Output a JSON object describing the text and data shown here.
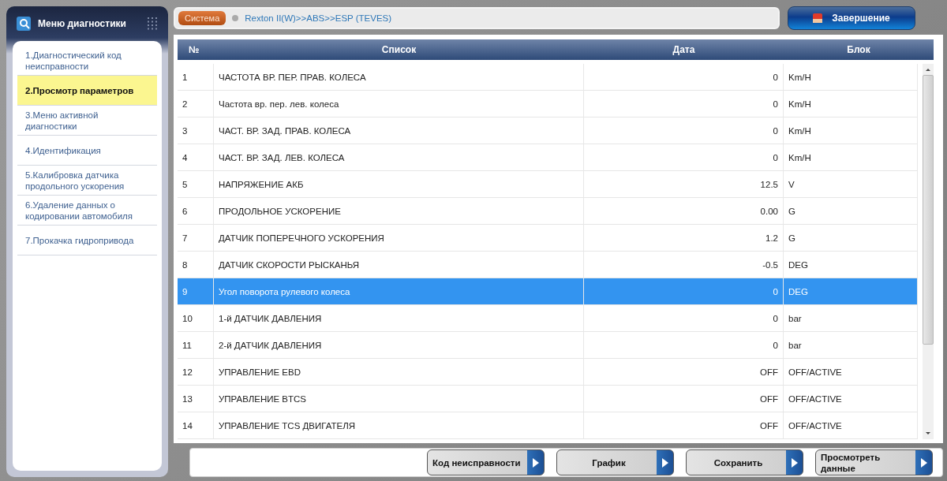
{
  "sidebar": {
    "title": "Меню диагностики",
    "items": [
      {
        "label": "1.Диагностический код неисправности",
        "selected": false
      },
      {
        "label": "2.Просмотр параметров",
        "selected": true
      },
      {
        "label": "3.Меню активной диагностики",
        "selected": false
      },
      {
        "label": "4.Идентификация",
        "selected": false
      },
      {
        "label": "5.Калибровка датчика продольного ускорения",
        "selected": false
      },
      {
        "label": "6.Удаление данных о кодировании автомобиля",
        "selected": false
      },
      {
        "label": "7.Прокачка гидропривода",
        "selected": false
      }
    ]
  },
  "breadcrumb": {
    "system": "Система",
    "path": "Rexton II(W)>>ABS>>ESP (TEVES)"
  },
  "exit_button": "Завершение",
  "table": {
    "columns": [
      "№",
      "Список",
      "Дата",
      "Блок"
    ],
    "rows": [
      {
        "no": "1",
        "name": "ЧАСТОТА ВР. ПЕР. ПРАВ. КОЛЕСА",
        "value": "0",
        "unit": "Km/H",
        "selected": false
      },
      {
        "no": "2",
        "name": "Частота вр. пер. лев. колеса",
        "value": "0",
        "unit": "Km/H",
        "selected": false
      },
      {
        "no": "3",
        "name": "ЧАСТ. ВР. ЗАД. ПРАВ. КОЛЕСА",
        "value": "0",
        "unit": "Km/H",
        "selected": false
      },
      {
        "no": "4",
        "name": "ЧАСТ. ВР. ЗАД. ЛЕВ. КОЛЕСА",
        "value": "0",
        "unit": "Km/H",
        "selected": false
      },
      {
        "no": "5",
        "name": "НАПРЯЖЕНИЕ АКБ",
        "value": "12.5",
        "unit": "V",
        "selected": false
      },
      {
        "no": "6",
        "name": "ПРОДОЛЬНОЕ УСКОРЕНИЕ",
        "value": "0.00",
        "unit": "G",
        "selected": false
      },
      {
        "no": "7",
        "name": "ДАТЧИК ПОПЕРЕЧНОГО УСКОРЕНИЯ",
        "value": "1.2",
        "unit": "G",
        "selected": false
      },
      {
        "no": "8",
        "name": "ДАТЧИК СКОРОСТИ РЫСКАНЬЯ",
        "value": "-0.5",
        "unit": "DEG",
        "selected": false
      },
      {
        "no": "9",
        "name": "Угол поворота рулевого колеса",
        "value": "0",
        "unit": "DEG",
        "selected": true
      },
      {
        "no": "10",
        "name": "1-й ДАТЧИК ДАВЛЕНИЯ",
        "value": "0",
        "unit": "bar",
        "selected": false
      },
      {
        "no": "11",
        "name": "2-й ДАТЧИК ДАВЛЕНИЯ",
        "value": "0",
        "unit": "bar",
        "selected": false
      },
      {
        "no": "12",
        "name": "УПРАВЛЕНИЕ EBD",
        "value": "OFF",
        "unit": "OFF/ACTIVE",
        "selected": false
      },
      {
        "no": "13",
        "name": "УПРАВЛЕНИЕ BTCS",
        "value": "OFF",
        "unit": "OFF/ACTIVE",
        "selected": false
      },
      {
        "no": "14",
        "name": "УПРАВЛЕНИЕ TCS ДВИГАТЕЛЯ",
        "value": "OFF",
        "unit": "OFF/ACTIVE",
        "selected": false
      }
    ]
  },
  "buttons": [
    "Код неисправности",
    "График",
    "Сохранить",
    "Просмотреть данные"
  ]
}
